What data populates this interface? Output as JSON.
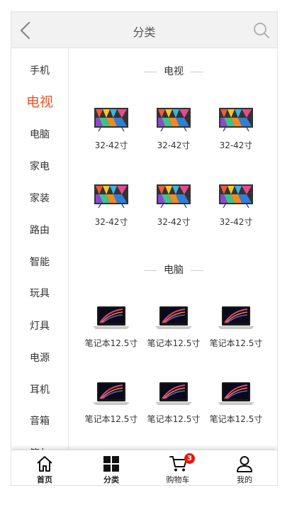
{
  "header": {
    "title": "分类"
  },
  "sidebar": {
    "items": [
      {
        "label": "手机"
      },
      {
        "label": "电视"
      },
      {
        "label": "电脑"
      },
      {
        "label": "家电"
      },
      {
        "label": "家装"
      },
      {
        "label": "路由"
      },
      {
        "label": "智能"
      },
      {
        "label": "玩具"
      },
      {
        "label": "灯具"
      },
      {
        "label": "电源"
      },
      {
        "label": "耳机"
      },
      {
        "label": "音箱"
      },
      {
        "label": "箱包"
      }
    ],
    "active_index": 1
  },
  "sections": [
    {
      "title": "电视",
      "products": [
        {
          "label": "32-42寸",
          "icon": "tv-icon"
        },
        {
          "label": "32-42寸",
          "icon": "tv-icon"
        },
        {
          "label": "32-42寸",
          "icon": "tv-icon"
        },
        {
          "label": "32-42寸",
          "icon": "tv-icon"
        },
        {
          "label": "32-42寸",
          "icon": "tv-icon"
        },
        {
          "label": "32-42寸",
          "icon": "tv-icon"
        }
      ]
    },
    {
      "title": "电脑",
      "products": [
        {
          "label": "笔记本12.5寸",
          "icon": "laptop-icon"
        },
        {
          "label": "笔记本12.5寸",
          "icon": "laptop-icon"
        },
        {
          "label": "笔记本12.5寸",
          "icon": "laptop-icon"
        },
        {
          "label": "笔记本12.5寸",
          "icon": "laptop-icon"
        },
        {
          "label": "笔记本12.5寸",
          "icon": "laptop-icon"
        },
        {
          "label": "笔记本12.5寸",
          "icon": "laptop-icon"
        }
      ]
    }
  ],
  "tabbar": {
    "tabs": [
      {
        "label": "首页",
        "icon": "home-icon"
      },
      {
        "label": "分类",
        "icon": "category-grid-icon"
      },
      {
        "label": "购物车",
        "icon": "cart-icon",
        "badge": "3"
      },
      {
        "label": "我的",
        "icon": "user-icon"
      }
    ],
    "active_index": 1
  },
  "colors": {
    "accent": "#e8562b",
    "badge": "#e8160c",
    "header_bg": "#f2f2f2"
  }
}
